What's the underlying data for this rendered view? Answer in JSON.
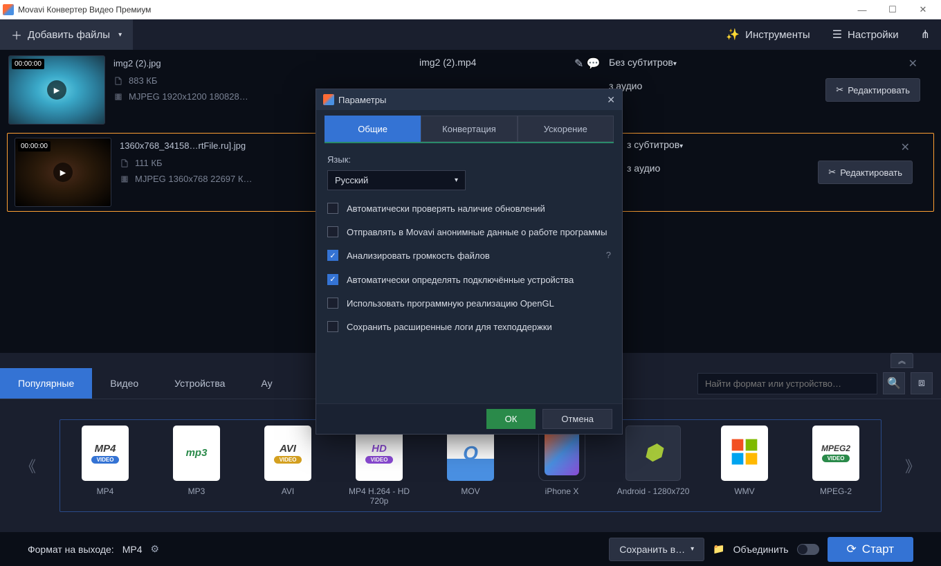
{
  "window": {
    "title": "Movavi Конвертер Видео Премиум"
  },
  "toolbar": {
    "add_files": "Добавить файлы",
    "tools": "Инструменты",
    "settings": "Настройки"
  },
  "files": [
    {
      "timestamp": "00:00:00",
      "name": "img2 (2).jpg",
      "size": "883 КБ",
      "codec": "MJPEG 1920x1200 180828…",
      "output_name": "img2 (2).mp4",
      "subtitle": "Без субтитров",
      "audio": "з аудио",
      "edit": "Редактировать"
    },
    {
      "timestamp": "00:00:00",
      "name": "1360x768_34158…rtFile.ru].jpg",
      "size": "111 КБ",
      "codec": "MJPEG 1360x768 22697 К…",
      "subtitle": "з субтитров",
      "audio": "з аудио",
      "edit": "Редактировать"
    }
  ],
  "format_tabs": {
    "popular": "Популярные",
    "video": "Видео",
    "devices": "Устройства",
    "au": "Ау",
    "search_placeholder": "Найти формат или устройство…"
  },
  "formats": [
    {
      "icon": "MP4",
      "sub": "VIDEO",
      "label": "MP4"
    },
    {
      "icon": "mp3",
      "sub": "",
      "label": "MP3"
    },
    {
      "icon": "AVI",
      "sub": "VIDEO",
      "label": "AVI"
    },
    {
      "icon": "HD",
      "sub": "VIDEO",
      "label": "MP4 H.264 - HD 720p"
    },
    {
      "icon": "Q",
      "sub": "",
      "label": "MOV"
    },
    {
      "icon": "phone",
      "sub": "",
      "label": "iPhone X"
    },
    {
      "icon": "android",
      "sub": "",
      "label": "Android - 1280x720"
    },
    {
      "icon": "win",
      "sub": "",
      "label": "WMV"
    },
    {
      "icon": "MPEG2",
      "sub": "VIDEO",
      "label": "MPEG-2"
    }
  ],
  "bottom": {
    "format_label": "Формат на выходе:",
    "format_value": "MP4",
    "save_to": "Сохранить в…",
    "merge": "Объединить",
    "start": "Старт"
  },
  "modal": {
    "title": "Параметры",
    "tabs": {
      "general": "Общие",
      "convert": "Конвертация",
      "accel": "Ускорение"
    },
    "lang_label": "Язык:",
    "lang_value": "Русский",
    "checks": [
      {
        "checked": false,
        "text": "Автоматически проверять наличие обновлений"
      },
      {
        "checked": false,
        "text": "Отправлять в Movavi анонимные данные о работе программы"
      },
      {
        "checked": true,
        "text": "Анализировать громкость файлов",
        "help": true
      },
      {
        "checked": true,
        "text": "Автоматически определять подключённые устройства"
      },
      {
        "checked": false,
        "text": "Использовать программную реализацию OpenGL"
      },
      {
        "checked": false,
        "text": "Сохранить расширенные логи для техподдержки"
      }
    ],
    "ok": "ОК",
    "cancel": "Отмена"
  }
}
